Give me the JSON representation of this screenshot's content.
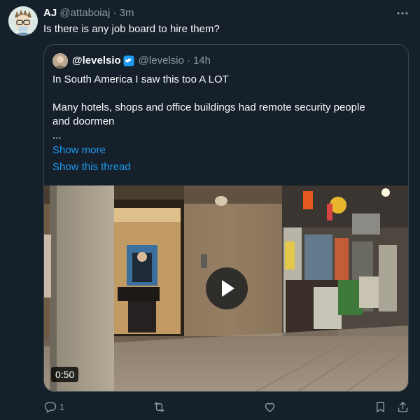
{
  "tweet": {
    "display_name": "AJ",
    "handle": "@attaboiaj",
    "separator": "·",
    "time": "3m",
    "more_icon": "more-horizontal-icon",
    "text": "Is there is any job board to hire them?"
  },
  "quote": {
    "display_name": "@levelsio",
    "verified_icon": "verified-badge-icon",
    "handle": "@levelsio",
    "separator": "·",
    "time": "14h",
    "line1": "In South America I saw this too A LOT",
    "line2": "Many hotels, shops and office buildings had remote security people",
    "line3": "and doormen",
    "ellipsis": "...",
    "show_more": "Show more",
    "show_thread": "Show this thread",
    "video": {
      "duration": "0:50",
      "play_icon": "play-icon"
    }
  },
  "actions": {
    "reply_count": "1",
    "reply_icon": "reply-icon",
    "retweet_icon": "retweet-icon",
    "like_icon": "heart-icon",
    "bookmark_icon": "bookmark-icon",
    "share_icon": "share-icon"
  },
  "colors": {
    "background": "#15202b",
    "text": "#f7f9f9",
    "secondary": "#8b98a5",
    "link": "#1d9bf0",
    "border": "#38444d"
  }
}
